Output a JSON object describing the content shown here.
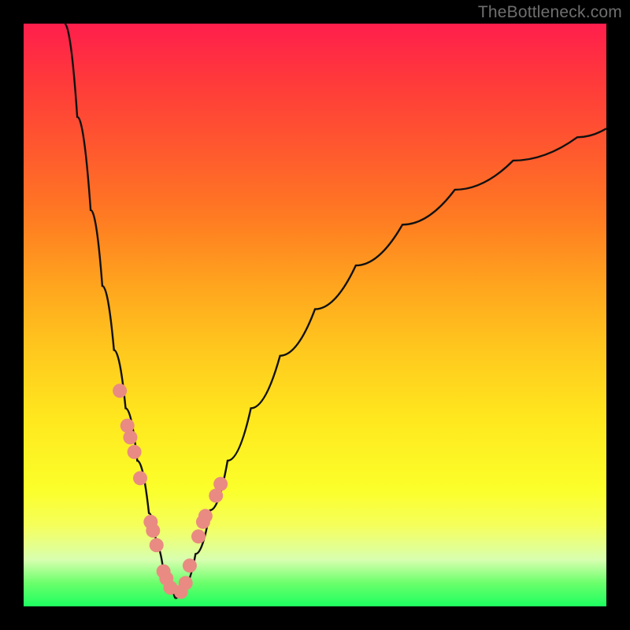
{
  "watermark": {
    "text": "TheBottleneck.com"
  },
  "colors": {
    "background": "#000000",
    "curve_stroke": "#121111",
    "dot_fill": "#e98b82",
    "gradient": [
      "#ff1e4c",
      "#ff3a3a",
      "#ff5a2e",
      "#ff7a22",
      "#ffa51e",
      "#ffc81e",
      "#ffe81e",
      "#fbff2a",
      "#f6ff5a",
      "#d8ffb0",
      "#6bff6b",
      "#1dff60"
    ]
  },
  "chart_data": {
    "type": "line",
    "title": "",
    "xlabel": "",
    "ylabel": "",
    "xlim": [
      0,
      100
    ],
    "ylim": [
      0,
      100
    ],
    "grid": false,
    "legend_position": "none",
    "description": "Two-branch bottleneck curve over a vertical red-to-green gradient. Vertical axis encodes bottleneck severity (top=red=100 severe, bottom=green=0 none). Curve minimum near x≈26. Salmon dots mark sampled points clustered in the low-severity region.",
    "series": [
      {
        "name": "left-branch",
        "x": [
          7.0,
          9.2,
          11.5,
          13.5,
          15.5,
          17.5,
          19.5,
          21.5,
          22.8,
          24.0,
          25.0,
          26.0
        ],
        "values": [
          100.0,
          84.0,
          68.0,
          55.0,
          44.0,
          34.0,
          25.0,
          16.0,
          10.5,
          6.0,
          3.0,
          1.4
        ]
      },
      {
        "name": "right-branch",
        "x": [
          26.0,
          27.5,
          29.5,
          32.0,
          35.0,
          39.0,
          44.0,
          50.0,
          57.0,
          65.0,
          74.0,
          84.0,
          95.0,
          100.0
        ],
        "values": [
          1.4,
          3.5,
          9.0,
          16.5,
          25.0,
          34.0,
          43.0,
          51.0,
          58.5,
          65.5,
          71.5,
          76.5,
          80.5,
          82.0
        ]
      },
      {
        "name": "dots",
        "x": [
          16.5,
          17.8,
          18.3,
          19.0,
          20.0,
          21.8,
          22.2,
          22.8,
          24.0,
          24.5,
          25.2,
          27.0,
          27.8,
          28.5,
          30.0,
          30.8,
          31.2,
          33.0,
          33.8
        ],
        "values": [
          37.0,
          31.0,
          29.0,
          26.5,
          22.0,
          14.5,
          13.0,
          10.5,
          6.0,
          4.8,
          3.2,
          2.5,
          4.0,
          7.0,
          12.0,
          14.5,
          15.5,
          19.0,
          21.0
        ]
      }
    ]
  }
}
